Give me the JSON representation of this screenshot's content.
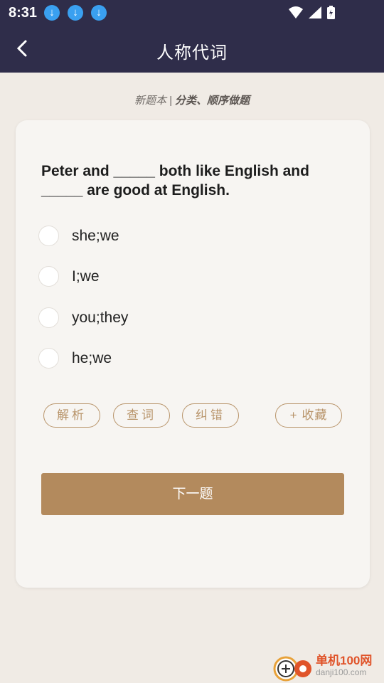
{
  "status": {
    "time": "8:31",
    "download_icons": [
      "download-icon",
      "download-icon",
      "download-icon"
    ]
  },
  "header": {
    "title": "人称代词"
  },
  "subtitle": {
    "source": "新题本",
    "separator": "|",
    "mode": "分类、顺序做题"
  },
  "question": {
    "text": "Peter and _____ both like English and _____ are good at English.",
    "options": [
      {
        "label": "she;we"
      },
      {
        "label": "I;we"
      },
      {
        "label": "you;they"
      },
      {
        "label": "he;we"
      }
    ]
  },
  "actions": {
    "analysis": "解析",
    "lookup": "查词",
    "report": "纠错",
    "favorite": "+ 收藏"
  },
  "next_label": "下一题",
  "watermark": {
    "name": "单机100网",
    "url": "danji100.com"
  },
  "colors": {
    "bar": "#2f2d4a",
    "accent": "#b38a5d",
    "page_bg": "#f0ebe5"
  }
}
